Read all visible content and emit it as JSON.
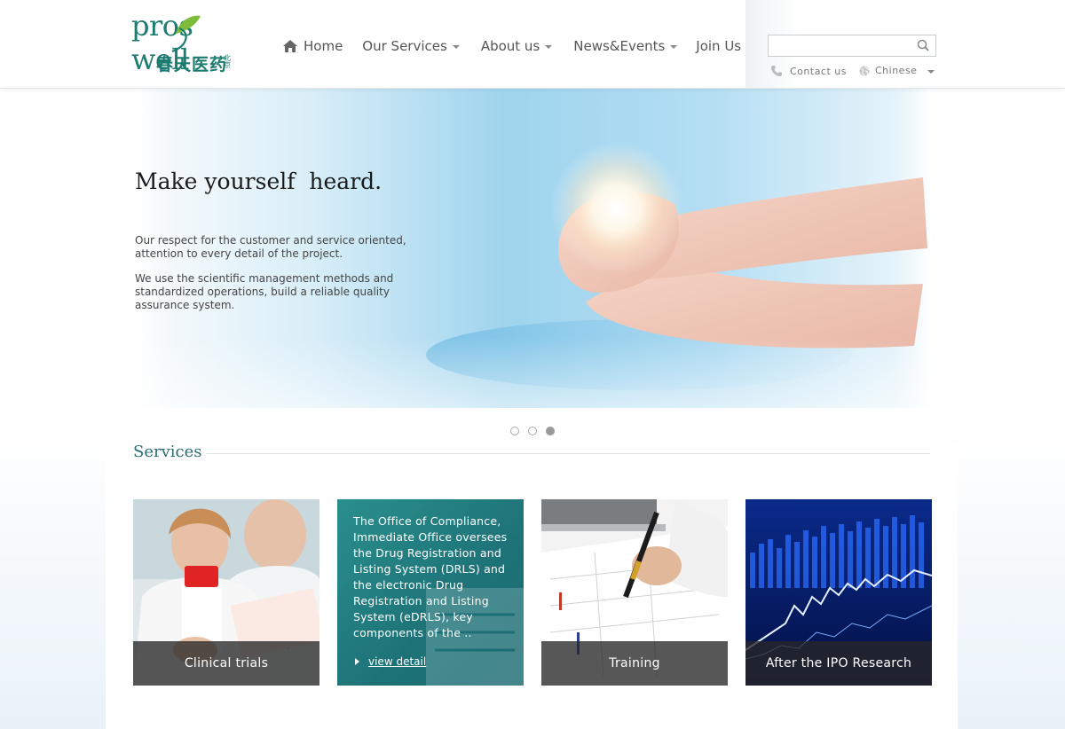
{
  "brand": {
    "name_en": "pros well",
    "name_cn": "春天医药",
    "name_cn_small": "北京",
    "color": "#1d7b70"
  },
  "nav": {
    "items": [
      {
        "label": "Home",
        "icon": "home-icon"
      },
      {
        "label": "Our Services",
        "dropdown": true
      },
      {
        "label": "About us",
        "dropdown": true
      },
      {
        "label": "News&Events",
        "dropdown": true
      },
      {
        "label": "Join Us"
      }
    ]
  },
  "search": {
    "value": "",
    "placeholder": ""
  },
  "utility": {
    "contact": "Contact us",
    "language": "Chinese"
  },
  "hero": {
    "title": "Make yourself  heard.",
    "paragraph1": "Our respect for the customer and service oriented, attention to every detail of the project.",
    "paragraph2": "We use the scientific management methods and standardized operations, build a reliable quality assurance system.",
    "slides_total": 3,
    "active_slide": 3
  },
  "services": {
    "title": "Services",
    "cards": [
      {
        "caption": "Clinical trials"
      },
      {
        "text": "The Office of Compliance, Immediate Office oversees the Drug Registration and Listing System (DRLS) and the electronic Drug Registration and Listing System (eDRLS), key components of the ..",
        "link": "view detail"
      },
      {
        "caption": "Training"
      },
      {
        "caption": "After the IPO Research"
      }
    ]
  },
  "colors": {
    "teal": "#1e7d80",
    "heading": "#2a6f73",
    "overlay": "#282828"
  }
}
